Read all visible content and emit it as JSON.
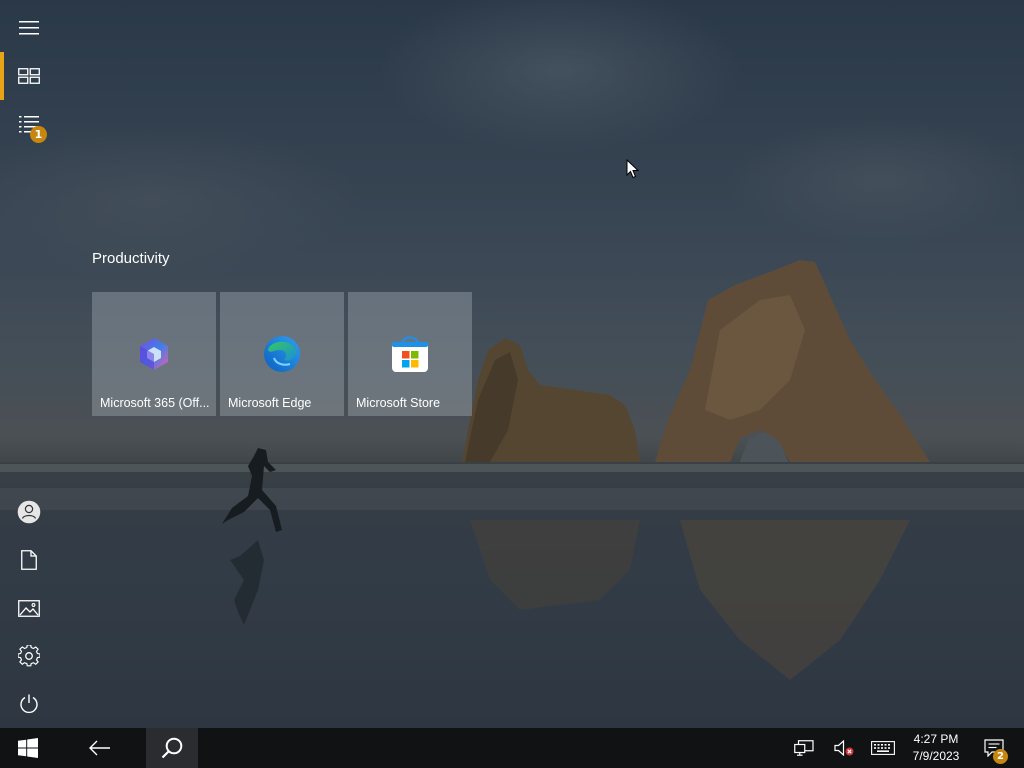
{
  "start_rail": {
    "top": [
      {
        "name": "expand-menu",
        "icon": "hamburger-icon"
      },
      {
        "name": "pinned-tiles",
        "icon": "tiles-icon",
        "active": true
      },
      {
        "name": "all-apps",
        "icon": "app-list-icon",
        "badge": "1"
      }
    ],
    "bottom": [
      {
        "name": "account",
        "icon": "user-icon"
      },
      {
        "name": "documents",
        "icon": "document-icon"
      },
      {
        "name": "pictures",
        "icon": "pictures-icon"
      },
      {
        "name": "settings",
        "icon": "gear-icon"
      },
      {
        "name": "power",
        "icon": "power-icon"
      }
    ]
  },
  "tile_group": {
    "title": "Productivity",
    "tiles": [
      {
        "label": "Microsoft 365 (Off...",
        "icon": "microsoft-365-icon"
      },
      {
        "label": "Microsoft Edge",
        "icon": "edge-icon"
      },
      {
        "label": "Microsoft Store",
        "icon": "store-icon"
      }
    ]
  },
  "taskbar": {
    "start_icon": "windows-logo-icon",
    "back_icon": "back-arrow-icon",
    "search_icon": "search-icon",
    "tray": {
      "network_icon": "network-icon",
      "volume_icon": "volume-muted-icon",
      "keyboard_icon": "touch-keyboard-icon"
    },
    "clock": {
      "time": "4:27 PM",
      "date": "7/9/2023"
    },
    "notifications": {
      "icon": "action-center-icon",
      "count": "2"
    }
  },
  "colors": {
    "accent": "#e8a317",
    "badge": "#c6860f",
    "taskbar": "#101214",
    "tile": "#aab2ba"
  }
}
